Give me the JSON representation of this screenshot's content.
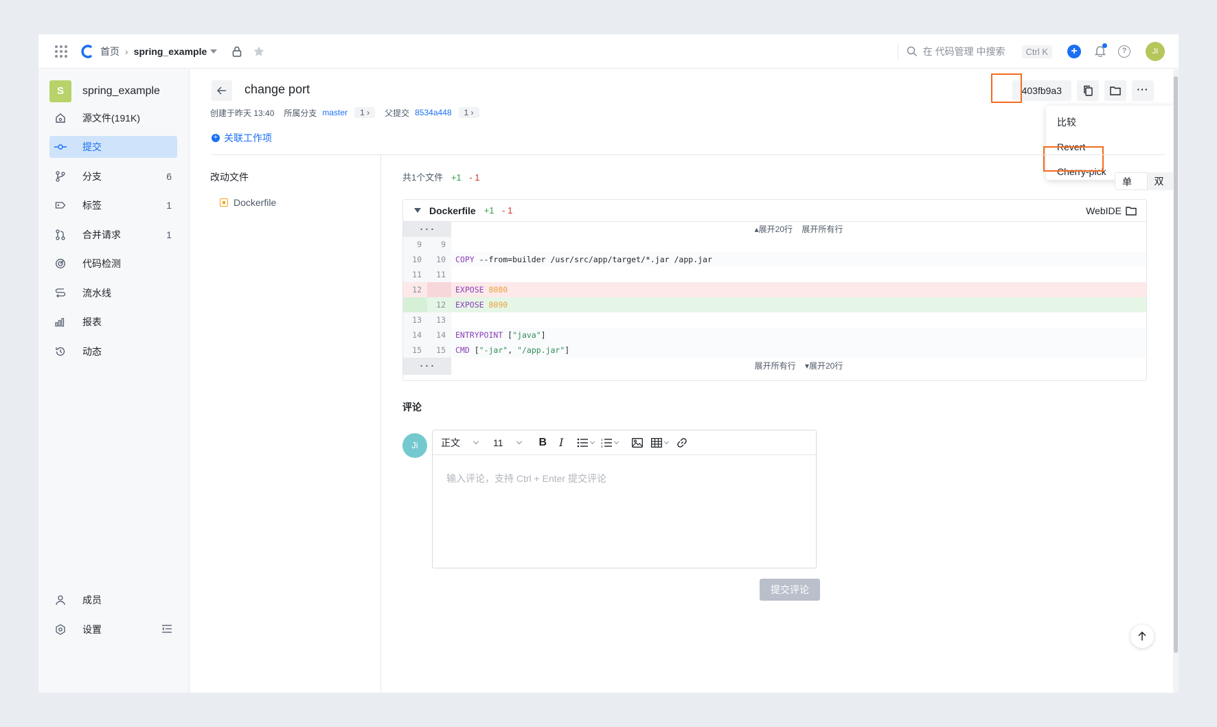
{
  "topbar": {
    "home": "首页",
    "repo": "spring_example",
    "search_placeholder": "在 代码管理 中搜索",
    "shortcut": "Ctrl K",
    "user_initials": "JI"
  },
  "sidebar": {
    "repo_badge": "S",
    "repo_name": "spring_example",
    "items": [
      {
        "label": "源文件(191K)",
        "count": ""
      },
      {
        "label": "提交",
        "count": ""
      },
      {
        "label": "分支",
        "count": "6"
      },
      {
        "label": "标签",
        "count": "1"
      },
      {
        "label": "合并请求",
        "count": "1"
      },
      {
        "label": "代码检测",
        "count": ""
      },
      {
        "label": "流水线",
        "count": ""
      },
      {
        "label": "报表",
        "count": ""
      },
      {
        "label": "动态",
        "count": ""
      }
    ],
    "bottom": [
      {
        "label": "成员"
      },
      {
        "label": "设置"
      }
    ]
  },
  "commit": {
    "title": "change port",
    "created": "创建于昨天 13:40",
    "branch_label": "所属分支",
    "branch": "master",
    "branch_count": "1",
    "parent_label": "父提交",
    "parent": "8534a448",
    "parent_count": "1",
    "hash": "403fb9a3",
    "link_work_item": "关联工作项"
  },
  "menu": {
    "items": [
      "比较",
      "Revert",
      "Cherry-pick"
    ]
  },
  "files": {
    "title": "改动文件",
    "list": [
      "Dockerfile"
    ],
    "summary": "共1个文件",
    "plus": "+1",
    "minus": "- 1",
    "view_single": "单栏",
    "view_double": "双栏"
  },
  "diff": {
    "file": "Dockerfile",
    "plus": "+1",
    "minus": "- 1",
    "webide": "WebIDE",
    "expand_top": "▴展开20行",
    "expand_all": "展开所有行",
    "expand_bottom": "▾展开20行",
    "lines": [
      {
        "old": "9",
        "new": "9",
        "code": ""
      },
      {
        "old": "10",
        "new": "10",
        "code": "COPY --from=builder /usr/src/app/target/*.jar /app.jar"
      },
      {
        "old": "11",
        "new": "11",
        "code": ""
      },
      {
        "old": "12",
        "new": "",
        "code": "EXPOSE 8080"
      },
      {
        "old": "",
        "new": "12",
        "code": "EXPOSE 8090"
      },
      {
        "old": "13",
        "new": "13",
        "code": ""
      },
      {
        "old": "14",
        "new": "14",
        "code": "ENTRYPOINT [\"java\"]"
      },
      {
        "old": "15",
        "new": "15",
        "code": "CMD [\"-jar\", \"/app.jar\"]"
      }
    ]
  },
  "comments": {
    "title": "评论",
    "avatar": "Ji",
    "font_style": "正文",
    "font_size": "11",
    "placeholder": "输入评论，支持 Ctrl + Enter 提交评论",
    "submit": "提交评论"
  },
  "colors": {
    "accent": "#1a6ff5",
    "highlight": "#f26b1d",
    "added": "#e5f6e6",
    "removed": "#fde9ea"
  }
}
